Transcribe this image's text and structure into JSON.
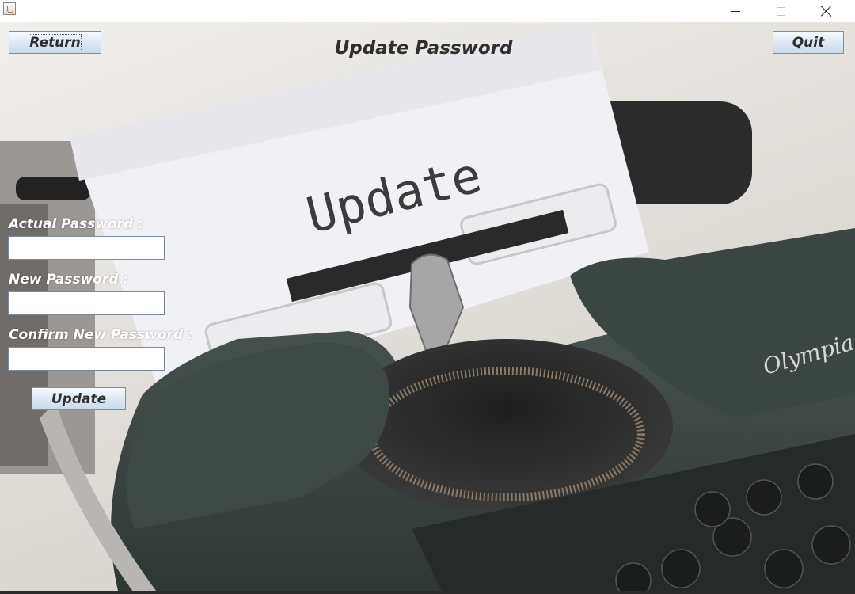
{
  "window": {
    "title": "",
    "icon": "java-cup-icon",
    "controls": [
      "minimize-icon",
      "maximize-icon",
      "close-icon"
    ]
  },
  "header": {
    "return_label": "Return",
    "title": "Update Password",
    "quit_label": "Quit"
  },
  "form": {
    "actual_label": "Actual Password :",
    "actual_value": "",
    "new_label": "New Password :",
    "new_value": "",
    "confirm_label": "Confirm New Password :",
    "confirm_value": "",
    "update_label": "Update"
  },
  "background": {
    "paper_text": "Update",
    "brand_text": "Olympia"
  },
  "colors": {
    "button_top": "#f7fbff",
    "button_bottom": "#cbd9e8",
    "label_text": "#ffffff",
    "title_text": "#2f2f2f",
    "typewriter_body": "#3a4440"
  }
}
